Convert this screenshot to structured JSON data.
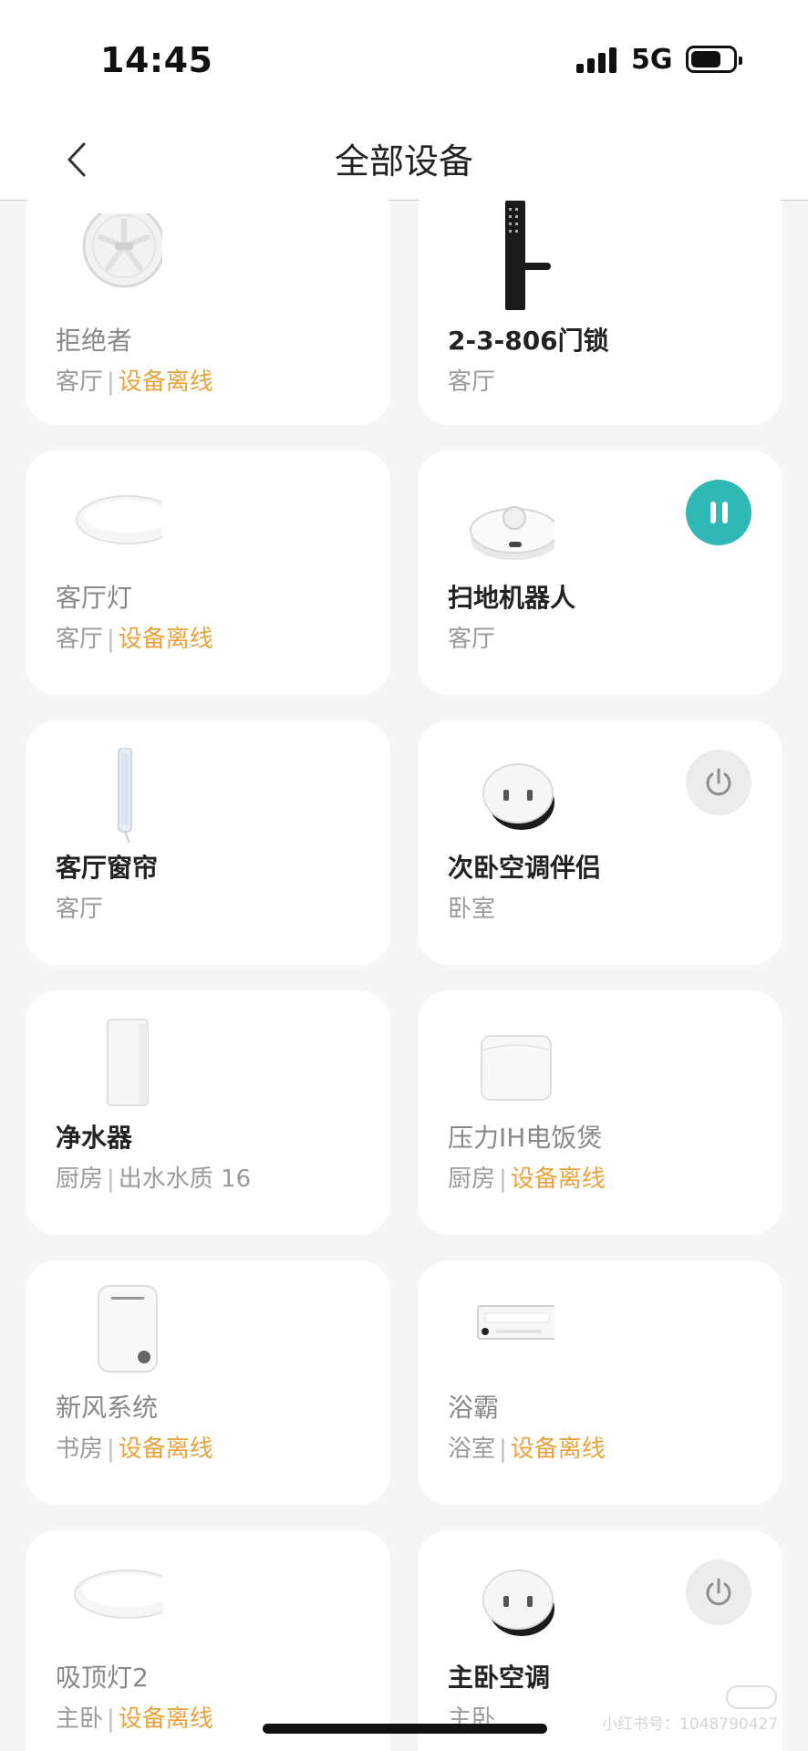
{
  "status_bar": {
    "time": "14:45",
    "network": "5G"
  },
  "nav": {
    "title": "全部设备"
  },
  "devices": [
    {
      "name": "拒绝者",
      "room": "客厅",
      "state": "设备离线",
      "icon": "fan-icon"
    },
    {
      "name": "2-3-806门锁",
      "room": "客厅",
      "state": "",
      "icon": "door-lock-icon"
    },
    {
      "name": "客厅灯",
      "room": "客厅",
      "state": "设备离线",
      "icon": "ceiling-light-icon"
    },
    {
      "name": "扫地机器人",
      "room": "客厅",
      "state": "",
      "icon": "robot-vacuum-icon",
      "control": "pause-icon"
    },
    {
      "name": "客厅窗帘",
      "room": "客厅",
      "state": "",
      "icon": "curtain-motor-icon"
    },
    {
      "name": "次卧空调伴侣",
      "room": "卧室",
      "state": "",
      "icon": "ac-companion-icon",
      "control": "power-icon"
    },
    {
      "name": "净水器",
      "room": "厨房",
      "state": "出水水质 16",
      "icon": "water-purifier-icon"
    },
    {
      "name": "压力IH电饭煲",
      "room": "厨房",
      "state": "设备离线",
      "icon": "rice-cooker-icon"
    },
    {
      "name": "新风系统",
      "room": "书房",
      "state": "设备离线",
      "icon": "fresh-air-icon"
    },
    {
      "name": "浴霸",
      "room": "浴室",
      "state": "设备离线",
      "icon": "bath-heater-icon"
    },
    {
      "name": "吸顶灯2",
      "room": "主卧",
      "state": "设备离线",
      "icon": "ceiling-light-icon"
    },
    {
      "name": "主卧空调",
      "room": "主卧",
      "state": "",
      "icon": "ac-companion-icon",
      "control": "power-icon"
    }
  ],
  "watermark": {
    "text": "小红书号：1048790427"
  },
  "colors": {
    "offline": "#e8a33d",
    "pause_button": "#2fb8b4",
    "card": "#ffffff",
    "background": "#f5f5f5"
  }
}
